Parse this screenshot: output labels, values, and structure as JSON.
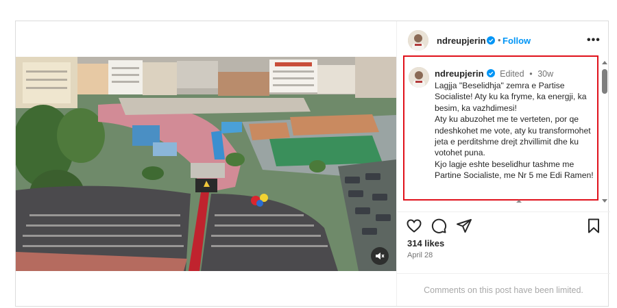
{
  "header": {
    "username": "ndreupjerin",
    "separator": "•",
    "follow_label": "Follow",
    "more_label": "•••"
  },
  "caption": {
    "username": "ndreupjerin",
    "edited_label": "Edited",
    "separator": "•",
    "age": "30w",
    "text": "Lagjja \"Beselidhja\" zemra e Partise Socialiste! Aty ku ka fryme, ka energji, ka besim, ka vazhdimesi!\nAty ku abuzohet me te verteten, por qe ndeshkohet me vote, aty ku transformohet jeta e perditshme drejt zhvillimit dhe ku votohet puna.\nKjo lagje eshte beselidhur tashme me Partine Socialiste, me Nr 5 me Edi Ramen!"
  },
  "actions": {
    "icons": [
      "heart-icon",
      "comment-icon",
      "share-icon",
      "bookmark-icon"
    ]
  },
  "likes": "314 likes",
  "date": "April 28",
  "comments_notice": "Comments on this post have been limited.",
  "colors": {
    "accent": "#0095f6",
    "highlight_border": "#e0101a",
    "verified": "#0095f6"
  }
}
